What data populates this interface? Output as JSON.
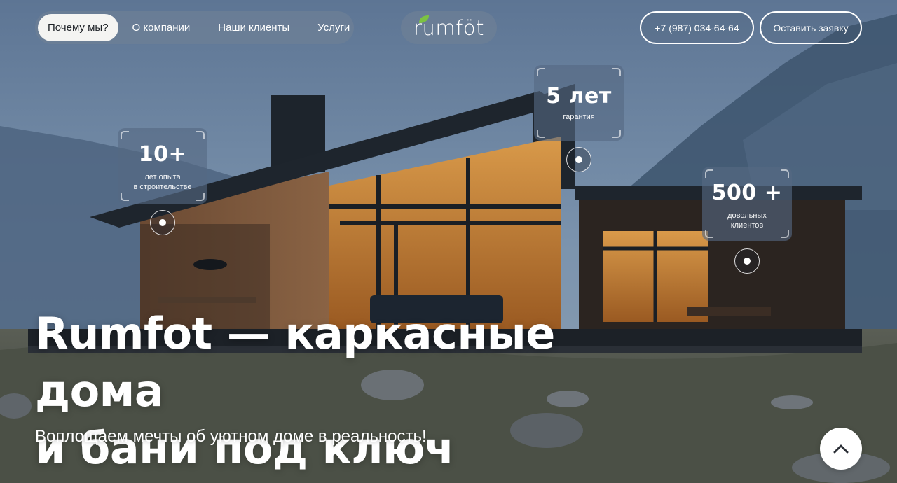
{
  "header": {
    "nav": [
      {
        "label": "Почему мы?",
        "active": true
      },
      {
        "label": "О компании",
        "active": false
      },
      {
        "label": "Наши клиенты",
        "active": false
      },
      {
        "label": "Услуги",
        "active": false
      }
    ],
    "logo": "rumföt",
    "phone": "+7 (987) 034-64-64",
    "order_button": "Оставить заявку"
  },
  "stats": [
    {
      "value": "10+",
      "caption_line1": "лет опыта",
      "caption_line2": "в строительстве"
    },
    {
      "value": "5 лет",
      "caption_line1": "гарантия",
      "caption_line2": ""
    },
    {
      "value": "500 +",
      "caption_line1": "довольных",
      "caption_line2": "клиентов"
    }
  ],
  "hero": {
    "title_line1": "Rumfot — каркасные дома",
    "title_line2": "и бани под ключ",
    "subtitle": "Воплощаем мечты об уютном доме в реальность!"
  },
  "icons": {
    "scroll_top": "chevron-up-icon",
    "logo_leaf": "leaf-icon"
  },
  "colors": {
    "accent_green": "#7cc242",
    "pill_bg": "#6e8096",
    "text_light": "#ffffff",
    "active_nav_bg": "#f4f4f2"
  }
}
